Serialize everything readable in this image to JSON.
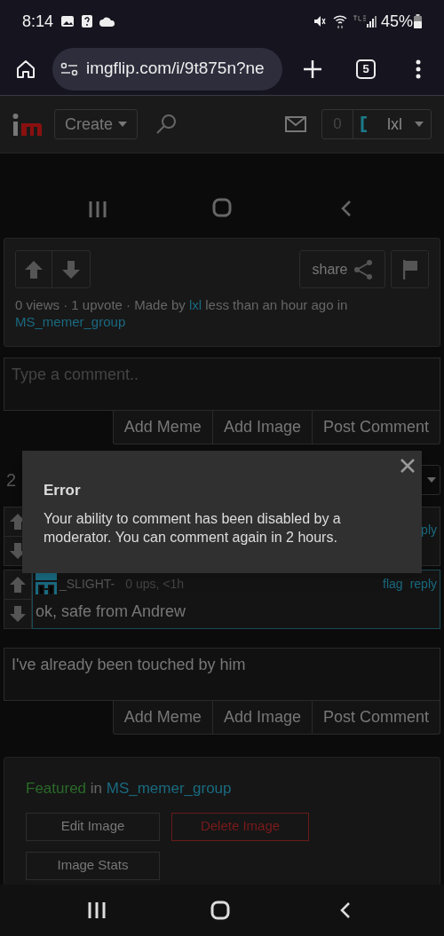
{
  "status_bar": {
    "time": "8:14",
    "battery": "45%"
  },
  "browser": {
    "url": "imgflip.com/i/9t875n?ne",
    "tab_count": "5"
  },
  "site_header": {
    "create_label": "Create",
    "notification_count": "0",
    "username": "lxl"
  },
  "post": {
    "separator": "·",
    "views": "0 views",
    "upvotes": "1 upvote",
    "made_by": "Made by",
    "author": "lxl",
    "time": "less than an hour ago in",
    "group": "MS_memer_group",
    "share_label": "share"
  },
  "comment_box": {
    "placeholder": "Type a comment..",
    "buttons": [
      "Add Meme",
      "Add Image",
      "Post Comment"
    ]
  },
  "comments_count": "2",
  "comments": [
    {
      "actions": [
        "ply"
      ]
    },
    {
      "username": "_SLIGHT-",
      "meta": "0 ups, <1h",
      "actions": [
        "flag",
        "reply"
      ],
      "text": "ok, safe from Andrew"
    }
  ],
  "reply_box": {
    "value": "I've already been touched by him",
    "buttons": [
      "Add Meme",
      "Add Image",
      "Post Comment"
    ]
  },
  "dialog": {
    "title": "Error",
    "message": "Your ability to comment has been disabled by a moderator. You can comment again in 2 hours."
  },
  "featured": {
    "label": "Featured",
    "connector": "in",
    "group": "MS_memer_group",
    "buttons": [
      {
        "label": "Edit Image",
        "kind": "default"
      },
      {
        "label": "Delete Image",
        "kind": "danger"
      },
      {
        "label": "Image Stats",
        "kind": "default"
      }
    ]
  }
}
